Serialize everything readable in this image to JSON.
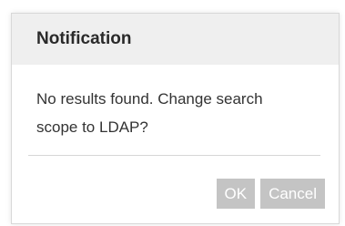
{
  "dialog": {
    "title": "Notification",
    "message": "No results found. Change search scope to LDAP?",
    "ok_label": "OK",
    "cancel_label": "Cancel"
  }
}
